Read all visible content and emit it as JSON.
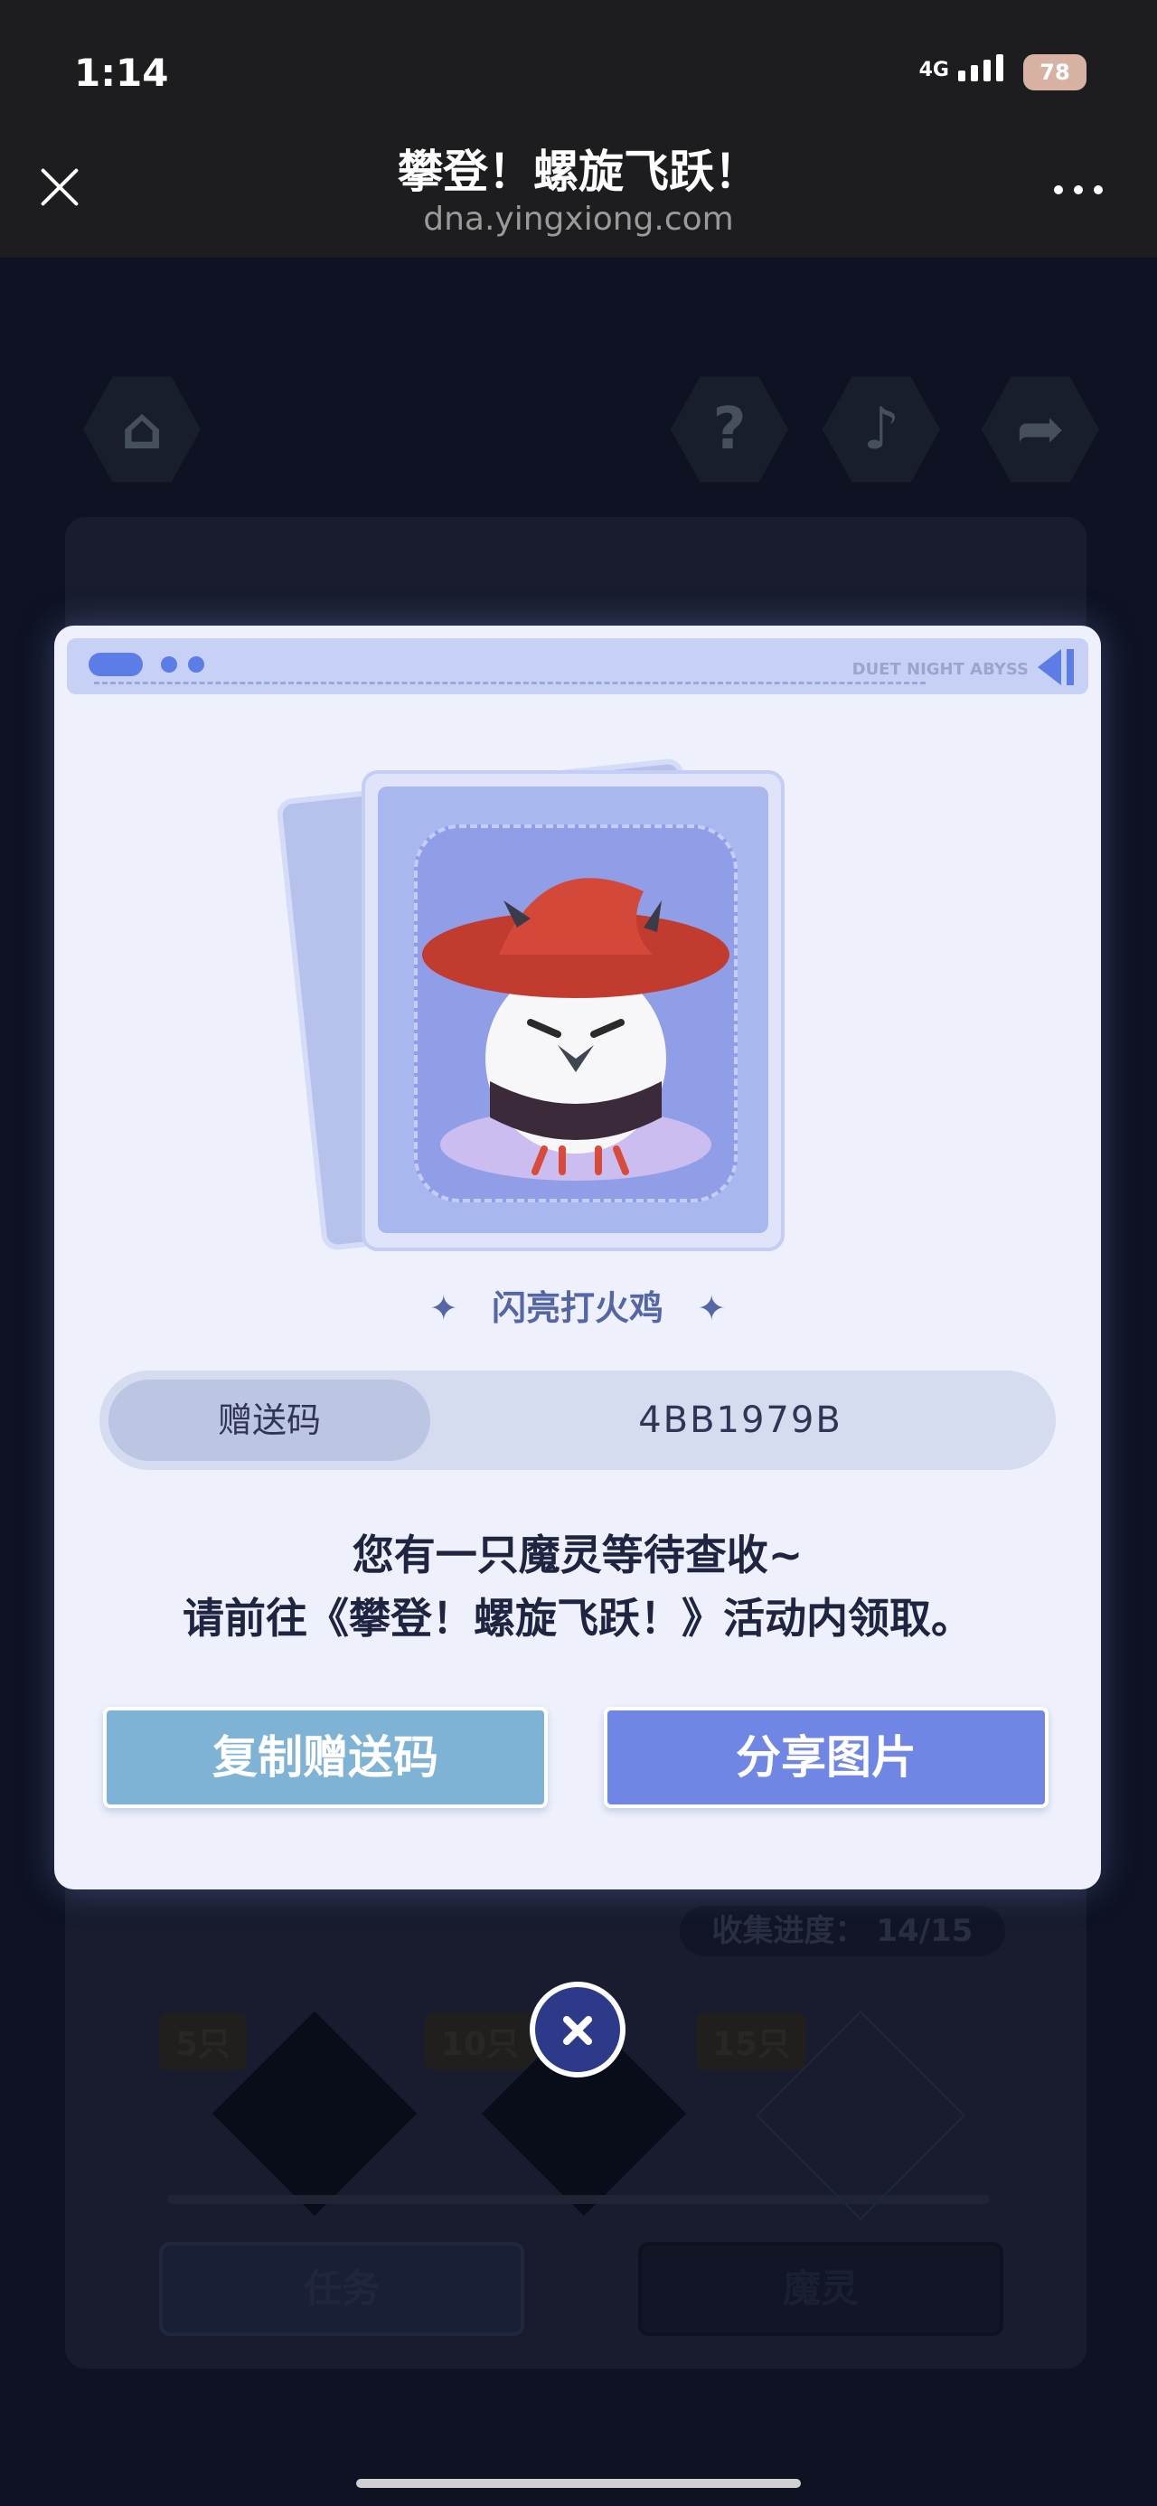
{
  "status_bar": {
    "time": "1:14",
    "network": "4G",
    "battery": "78"
  },
  "nav": {
    "title": "攀登！螺旋飞跃！",
    "url": "dna.yingxiong.com"
  },
  "background": {
    "icons": [
      "home-icon",
      "help-icon",
      "music-icon",
      "share-icon"
    ],
    "help_glyph": "?",
    "music_glyph": "♪",
    "home_glyph": "⌂",
    "share_glyph": "➦",
    "progress_text": "收集进度： 14/15",
    "milestones": [
      "5只",
      "10只",
      "15只"
    ],
    "tabs": {
      "task": "任务",
      "spirit": "魔灵"
    }
  },
  "modal": {
    "brand": "DUET NIGHT ABYSS",
    "item_name": "闪亮打火鸡",
    "code_label": "赠送码",
    "code_value": "4BB1979B",
    "message_line1": "您有一只魔灵等待查收~",
    "message_line2": "请前往《攀登！螺旋飞跃！》活动内领取。",
    "copy_button": "复制赠送码",
    "share_button": "分享图片",
    "sparkle": "✦"
  }
}
